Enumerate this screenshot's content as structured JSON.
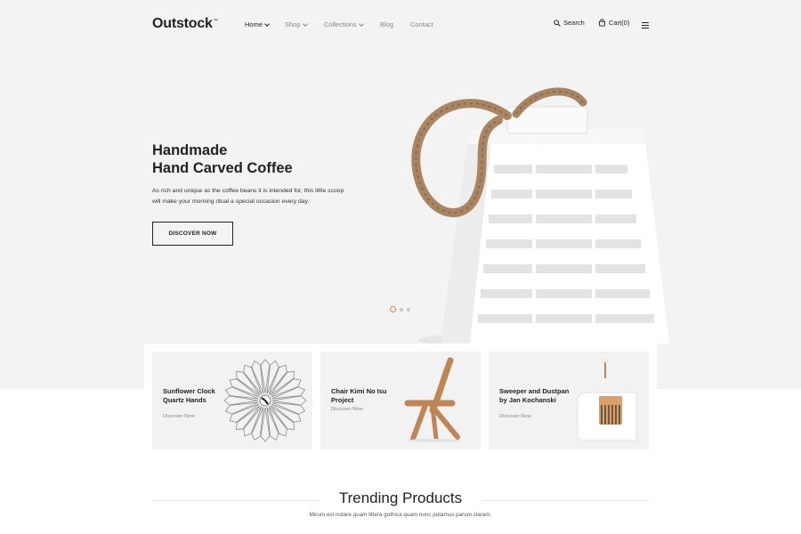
{
  "header": {
    "logo": "Outstock",
    "logo_mark": "™",
    "nav": [
      {
        "label": "Home",
        "has_dropdown": true,
        "active": true
      },
      {
        "label": "Shop",
        "has_dropdown": true,
        "active": false
      },
      {
        "label": "Collections",
        "has_dropdown": true,
        "active": false
      },
      {
        "label": "Blog",
        "has_dropdown": false,
        "active": false
      },
      {
        "label": "Contact",
        "has_dropdown": false,
        "active": false
      }
    ],
    "search_label": "Search",
    "cart_label": "Cart(0)",
    "icons": {
      "search": "search-icon",
      "cart": "cart-icon",
      "menu": "hamburger-menu-icon"
    }
  },
  "hero": {
    "title_line1": "Handmade",
    "title_line2": "Hand Carved Coffee",
    "description_line1": "As rich and unique as the coffee beans it is intended for, this little scoop",
    "description_line2": "will make your morning ritual a special occasion every day.",
    "button_label": "DISCOVER NOW",
    "slides": 3,
    "active_slide": 1,
    "accent_color": "#d08a5a"
  },
  "banners": [
    {
      "title_line1": "Sunflower Clock",
      "title_line2": "Quartz Hands",
      "link": "Discover Now"
    },
    {
      "title_line1": "Chair Kimi No Isu",
      "title_line2": "Project",
      "link": "Discover Now"
    },
    {
      "title_line1": "Sweeper and Dustpan",
      "title_line2": "by Jan Kochanski",
      "link": "Discover Now"
    }
  ],
  "trending": {
    "title": "Trending Products",
    "subtitle": "Mirum est notare quam littera gothica quam nunc putamus parum claram."
  }
}
